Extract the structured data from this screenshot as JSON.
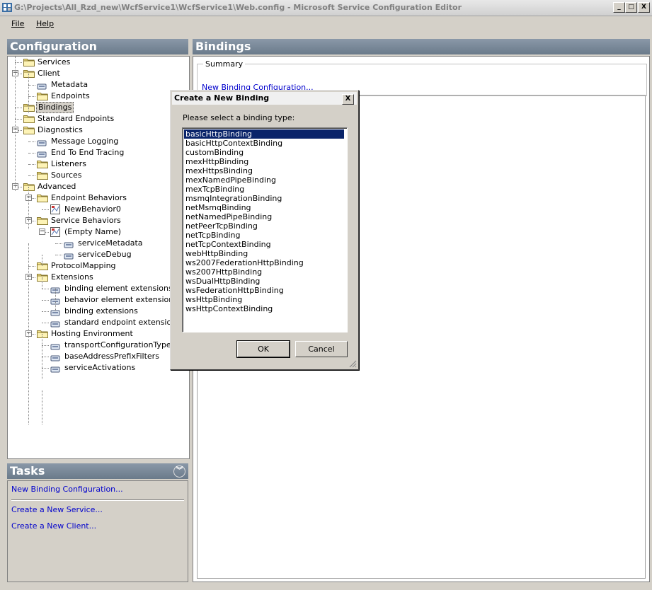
{
  "window": {
    "title": "G:\\Projects\\All_Rzd_new\\WcfService1\\WcfService1\\Web.config - Microsoft Service Configuration Editor",
    "minimize": "_",
    "maximize": "□",
    "close": "X"
  },
  "menu": [
    {
      "label": "File"
    },
    {
      "label": "Help"
    }
  ],
  "config_panel": {
    "title": "Configuration",
    "tree": [
      {
        "label": "Services",
        "level": 1,
        "type": "folder"
      },
      {
        "label": "Client",
        "level": 1,
        "type": "folder",
        "expanded": true
      },
      {
        "label": "Metadata",
        "level": 2,
        "type": "leaf"
      },
      {
        "label": "Endpoints",
        "level": 2,
        "type": "folder"
      },
      {
        "label": "Bindings",
        "level": 1,
        "type": "folder",
        "selected": true
      },
      {
        "label": "Standard Endpoints",
        "level": 1,
        "type": "folder"
      },
      {
        "label": "Diagnostics",
        "level": 1,
        "type": "folder",
        "expanded": true
      },
      {
        "label": "Message Logging",
        "level": 2,
        "type": "leaf"
      },
      {
        "label": "End To End Tracing",
        "level": 2,
        "type": "leaf"
      },
      {
        "label": "Listeners",
        "level": 2,
        "type": "folder"
      },
      {
        "label": "Sources",
        "level": 2,
        "type": "folder"
      },
      {
        "label": "Advanced",
        "level": 1,
        "type": "folder",
        "expanded": true
      },
      {
        "label": "Endpoint Behaviors",
        "level": 2,
        "type": "folder",
        "expanded": true
      },
      {
        "label": "NewBehavior0",
        "level": 3,
        "type": "item"
      },
      {
        "label": "Service Behaviors",
        "level": 2,
        "type": "folder",
        "expanded": true
      },
      {
        "label": "(Empty Name)",
        "level": 3,
        "type": "item",
        "expanded": true
      },
      {
        "label": "serviceMetadata",
        "level": 4,
        "type": "leaf"
      },
      {
        "label": "serviceDebug",
        "level": 4,
        "type": "leaf"
      },
      {
        "label": "ProtocolMapping",
        "level": 2,
        "type": "folder"
      },
      {
        "label": "Extensions",
        "level": 2,
        "type": "folder",
        "expanded": true
      },
      {
        "label": "binding element extensions",
        "level": 3,
        "type": "leaf"
      },
      {
        "label": "behavior element extensions",
        "level": 3,
        "type": "leaf"
      },
      {
        "label": "binding extensions",
        "level": 3,
        "type": "leaf"
      },
      {
        "label": "standard endpoint extensions",
        "level": 3,
        "type": "leaf"
      },
      {
        "label": "Hosting Environment",
        "level": 2,
        "type": "folder",
        "expanded": true
      },
      {
        "label": "transportConfigurationTypes",
        "level": 3,
        "type": "leaf"
      },
      {
        "label": "baseAddressPrefixFilters",
        "level": 3,
        "type": "leaf"
      },
      {
        "label": "serviceActivations",
        "level": 3,
        "type": "leaf"
      }
    ]
  },
  "tasks_panel": {
    "title": "Tasks",
    "links": [
      "New Binding Configuration...",
      "Create a New Service...",
      "Create a New Client..."
    ]
  },
  "bindings_panel": {
    "title": "Bindings",
    "summary_label": "Summary",
    "summary_link": "New Binding Configuration..."
  },
  "dialog": {
    "title": "Create a New Binding",
    "close": "X",
    "prompt": "Please select a binding type:",
    "options": [
      "basicHttpBinding",
      "basicHttpContextBinding",
      "customBinding",
      "mexHttpBinding",
      "mexHttpsBinding",
      "mexNamedPipeBinding",
      "mexTcpBinding",
      "msmqIntegrationBinding",
      "netMsmqBinding",
      "netNamedPipeBinding",
      "netPeerTcpBinding",
      "netTcpBinding",
      "netTcpContextBinding",
      "webHttpBinding",
      "ws2007FederationHttpBinding",
      "ws2007HttpBinding",
      "wsDualHttpBinding",
      "wsFederationHttpBinding",
      "wsHttpBinding",
      "wsHttpContextBinding"
    ],
    "selected": "basicHttpBinding",
    "ok_label": "OK",
    "cancel_label": "Cancel"
  }
}
